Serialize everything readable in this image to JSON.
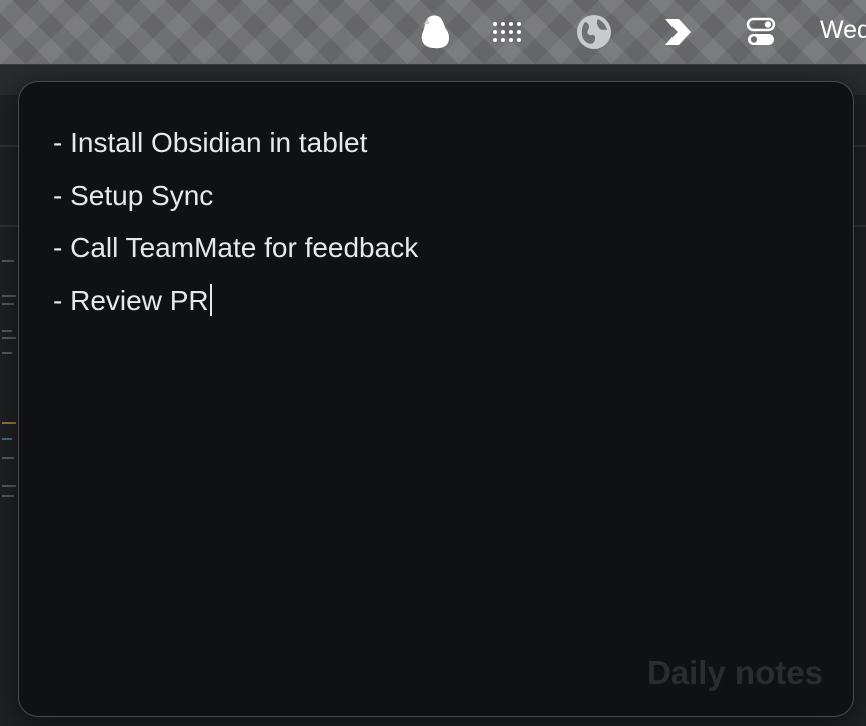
{
  "menubar": {
    "icons": [
      "evernote-icon",
      "grid-icon",
      "globe-icon",
      "arrow-logo-icon",
      "control-center-icon"
    ],
    "clock_text": "Wed"
  },
  "note": {
    "lines": [
      "- Install Obsidian in tablet",
      "- Setup Sync",
      "- Call TeamMate for feedback",
      "- Review PR"
    ],
    "watermark": "Daily notes"
  },
  "colors": {
    "panel_background": "#101115",
    "text": "#e8e8ea",
    "watermark": "#2b2c30",
    "menubar": "#6f7072"
  }
}
